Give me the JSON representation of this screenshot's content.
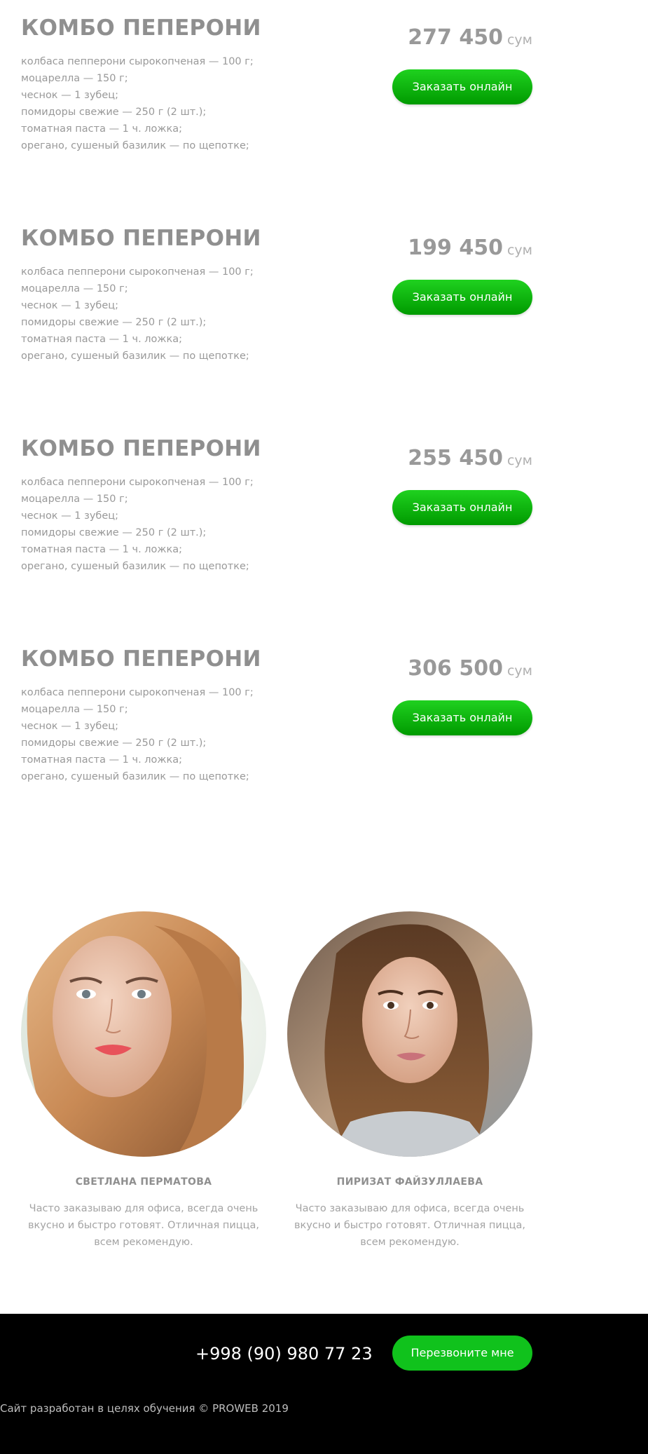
{
  "products": [
    {
      "title": "КОМБО ПЕПЕРОНИ",
      "price": "277 450",
      "currency": "сум",
      "order_label": "Заказать онлайн",
      "ingredients": [
        "колбаса пепперони сырокопченая — 100 г;",
        "моцарелла — 150 г;",
        "чеснок — 1 зубец;",
        "помидоры свежие — 250 г (2 шт.);",
        "томатная паста — 1 ч. ложка;",
        "орегано, сушеный базилик — по щепотке;"
      ]
    },
    {
      "title": "КОМБО ПЕПЕРОНИ",
      "price": "199 450",
      "currency": "сум",
      "order_label": "Заказать онлайн",
      "ingredients": [
        "колбаса пепперони сырокопченая — 100 г;",
        "моцарелла — 150 г;",
        "чеснок — 1 зубец;",
        "помидоры свежие — 250 г (2 шт.);",
        "томатная паста — 1 ч. ложка;",
        "орегано, сушеный базилик — по щепотке;"
      ]
    },
    {
      "title": "КОМБО ПЕПЕРОНИ",
      "price": "255 450",
      "currency": "сум",
      "order_label": "Заказать онлайн",
      "ingredients": [
        "колбаса пепперони сырокопченая — 100 г;",
        "моцарелла — 150 г;",
        "чеснок — 1 зубец;",
        "помидоры свежие — 250 г (2 шт.);",
        "томатная паста — 1 ч. ложка;",
        "орегано, сушеный базилик — по щепотке;"
      ]
    },
    {
      "title": "КОМБО ПЕПЕРОНИ",
      "price": "306 500",
      "currency": "сум",
      "order_label": "Заказать онлайн",
      "ingredients": [
        "колбаса пепперони сырокопченая — 100 г;",
        "моцарелла — 150 г;",
        "чеснок — 1 зубец;",
        "помидоры свежие — 250 г (2 шт.);",
        "томатная паста — 1 ч. ложка;",
        "орегано, сушеный базилик — по щепотке;"
      ]
    }
  ],
  "reviews": [
    {
      "name": "СВЕТЛАНА ПЕРМАТОВА",
      "text": "Часто заказываю для офиса, всегда очень вкусно и быстро готовят. Отличная пицца, всем рекомендую.",
      "photo": "customer-photo-blonde-woman"
    },
    {
      "name": "ПИРИЗАТ ФАЙЗУЛЛАЕВА",
      "text": "Часто заказываю для офиса, всегда очень вкусно и быстро готовят. Отличная пицца, всем рекомендую.",
      "photo": "customer-photo-brunette-woman"
    }
  ],
  "footer": {
    "phone": "+998 (90) 980 77 23",
    "callback_label": "Перезвоните мне",
    "copyright": "Сайт разработан в целях обучения © PROWEB 2019"
  },
  "colors": {
    "accent_green": "#10c21c",
    "footer_bg": "#000000",
    "text_gray": "#8f8f8f"
  }
}
